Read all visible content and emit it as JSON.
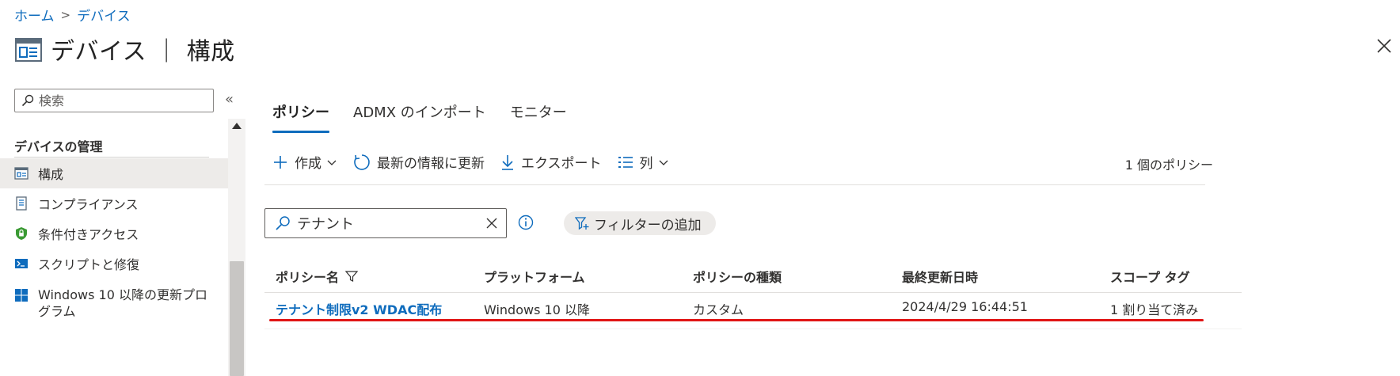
{
  "breadcrumb": {
    "home": "ホーム",
    "separator": ">",
    "current": "デバイス"
  },
  "header": {
    "title": "デバイス ｜ 構成",
    "more": "···"
  },
  "sidebar": {
    "search_placeholder": "検索",
    "collapse": "«",
    "section_title": "デバイスの管理",
    "items": [
      {
        "label": "構成",
        "icon": "configuration-icon",
        "active": true
      },
      {
        "label": "コンプライアンス",
        "icon": "compliance-icon"
      },
      {
        "label": "条件付きアクセス",
        "icon": "shield-lock-icon"
      },
      {
        "label": "スクリプトと修復",
        "icon": "script-icon"
      },
      {
        "label": "Windows 10 以降の更新プログラム",
        "icon": "windows-icon"
      }
    ]
  },
  "tabs": [
    {
      "label": "ポリシー",
      "active": true
    },
    {
      "label": "ADMX のインポート"
    },
    {
      "label": "モニター"
    }
  ],
  "toolbar": {
    "create": "作成",
    "refresh": "最新の情報に更新",
    "export": "エクスポート",
    "columns": "列",
    "policy_count": "1 個のポリシー"
  },
  "filter": {
    "search_value": "テナント",
    "add_filter": "フィルターの追加"
  },
  "table": {
    "columns": [
      "ポリシー名",
      "プラットフォーム",
      "ポリシーの種類",
      "最終更新日時",
      "スコープ タグ"
    ],
    "rows": [
      [
        "テナント制限v2 WDAC配布",
        "Windows 10 以降",
        "カスタム",
        "2024/4/29 16:44:51",
        "1 割り当て済み"
      ]
    ]
  },
  "colors": {
    "accent": "#0f6cbd",
    "highlight_underline": "#e01515",
    "active_nav_bg": "#edebe9"
  }
}
